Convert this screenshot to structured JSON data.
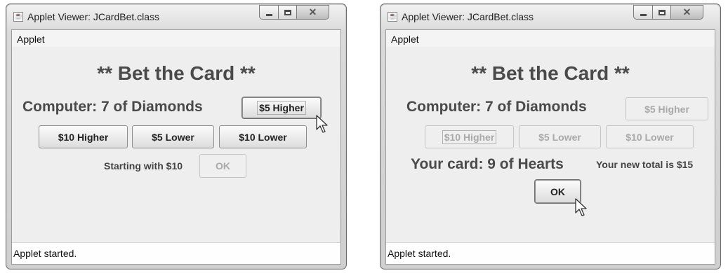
{
  "windows": [
    {
      "title": "Applet Viewer: JCardBet.class",
      "menu": "Applet",
      "heading": "** Bet the Card **",
      "computer_label": "Computer: 7 of Diamonds",
      "buttons": {
        "higher5": "$5 Higher",
        "higher10": "$10 Higher",
        "lower5": "$5 Lower",
        "lower10": "$10 Lower",
        "ok": "OK"
      },
      "status_message": "Starting with $10",
      "status_bar": "Applet started."
    },
    {
      "title": "Applet Viewer: JCardBet.class",
      "menu": "Applet",
      "heading": "** Bet the Card **",
      "computer_label": "Computer: 7 of Diamonds",
      "buttons": {
        "higher5": "$5 Higher",
        "higher10": "$10 Higher",
        "lower5": "$5 Lower",
        "lower10": "$10 Lower",
        "ok": "OK"
      },
      "your_card": "Your card: 9 of Hearts",
      "total_message": "Your new total is $15",
      "status_bar": "Applet started."
    }
  ],
  "colors": {
    "heading_text": "#4a4a4a",
    "disabled_text": "#a9a9a9",
    "client_bg": "#eeeeee"
  },
  "icons": [
    "java-applet-icon",
    "minimize-icon",
    "maximize-icon",
    "close-icon",
    "mouse-pointer-icon"
  ]
}
